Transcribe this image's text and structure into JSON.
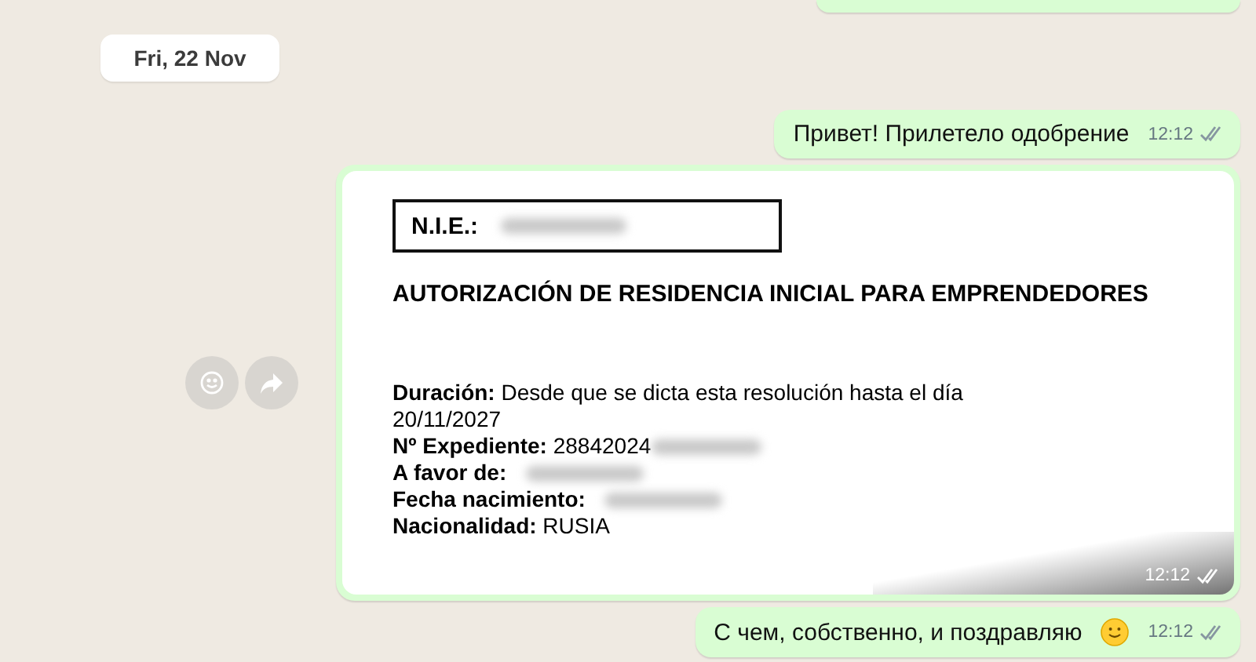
{
  "date_chip": "Fri, 22 Nov",
  "messages": [
    {
      "kind": "text",
      "text": "Привет! Прилетело одобрение",
      "time": "12:12",
      "read": false
    },
    {
      "kind": "document",
      "time": "12:12",
      "read": false,
      "document": {
        "nie_label": "N.I.E.:",
        "title": "AUTORIZACIÓN DE RESIDENCIA INICIAL PARA EMPRENDEDORES",
        "fields": [
          {
            "label": "Duración:",
            "value": "Desde que se dicta esta resolución hasta el día 20/11/2027",
            "blurred": false
          },
          {
            "label": "Nº Expediente:",
            "value": "28842024",
            "blurred": true
          },
          {
            "label": "A favor de:",
            "blurred": true
          },
          {
            "label": "Fecha nacimiento:",
            "blurred": true
          },
          {
            "label": "Nacionalidad:",
            "value": "RUSIA",
            "blurred": false
          }
        ]
      }
    },
    {
      "kind": "text",
      "text": "С чем, собственно, и поздравляю",
      "emoji": true,
      "time": "12:12",
      "read": false
    }
  ]
}
